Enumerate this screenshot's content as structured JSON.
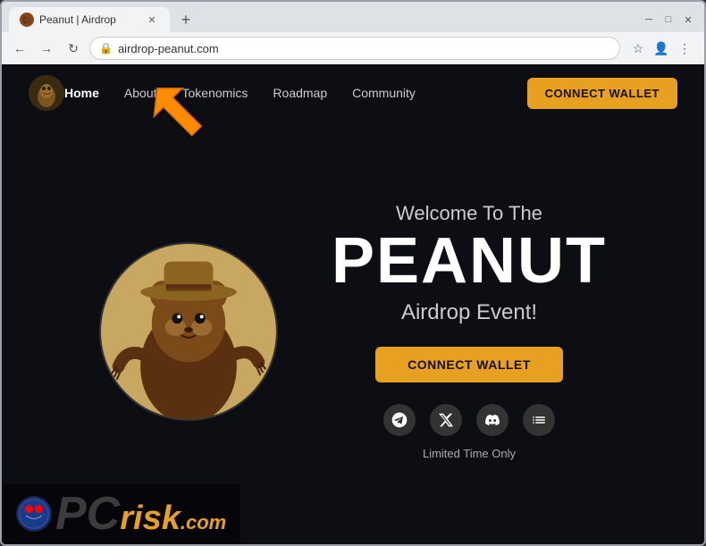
{
  "browser": {
    "tab_title": "Peanut | Airdrop",
    "url": "airdrop-peanut.com",
    "new_tab_symbol": "+",
    "back_symbol": "←",
    "forward_symbol": "→",
    "refresh_symbol": "↻"
  },
  "navbar": {
    "logo_emoji": "🐿",
    "links": [
      {
        "label": "Home",
        "active": true
      },
      {
        "label": "About",
        "active": false
      },
      {
        "label": "Tokenomics",
        "active": false
      },
      {
        "label": "Roadmap",
        "active": false
      },
      {
        "label": "Community",
        "active": false
      }
    ],
    "connect_wallet_label": "CONNECT WALLET"
  },
  "hero": {
    "welcome_text": "Welcome To The",
    "title": "PEANUT",
    "subtitle": "Airdrop Event!",
    "connect_wallet_label": "CONNECT WALLET",
    "limited_text": "Limited Time Only",
    "social_icons": [
      {
        "name": "telegram-icon",
        "symbol": "✈"
      },
      {
        "name": "twitter-icon",
        "symbol": "𝕏"
      },
      {
        "name": "discord-icon",
        "symbol": "⊗"
      },
      {
        "name": "chart-icon",
        "symbol": "📊"
      }
    ]
  },
  "colors": {
    "accent": "#e8a020",
    "background": "#0d0d14",
    "text_primary": "#ffffff",
    "text_secondary": "#cccccc"
  },
  "watermark": {
    "pc_text": "P",
    "c_text": "C",
    "risk_text": "risk",
    "com_text": ".com"
  }
}
